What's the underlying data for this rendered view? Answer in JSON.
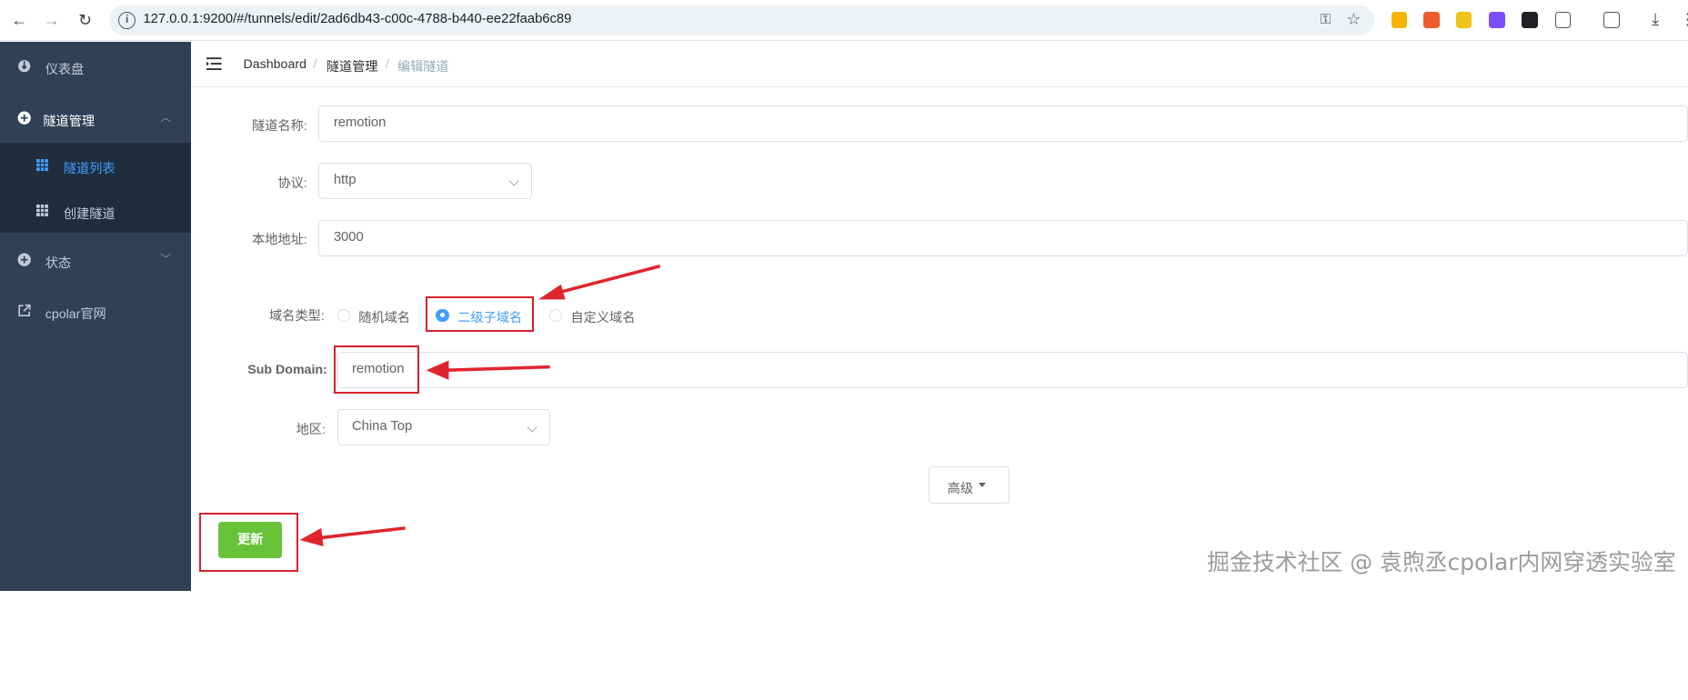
{
  "browser": {
    "url": "127.0.0.1:9200/#/tunnels/edit/2ad6db43-c00c-4788-b440-ee22faab6c89",
    "nav": {
      "back": "←",
      "forward": "→",
      "reload": "↻"
    },
    "key_icon": "⚿",
    "star_icon": "☆",
    "ext_download": "⤓",
    "ext_menu": "⋮"
  },
  "sidebar": {
    "items": [
      {
        "label": "仪表盘"
      },
      {
        "label": "隧道管理",
        "chevron": "︿"
      },
      {
        "label": "状态",
        "chevron": "﹀"
      },
      {
        "label": "cpolar官网"
      }
    ],
    "submenu": [
      {
        "label": "隧道列表",
        "active": true
      },
      {
        "label": "创建隧道"
      }
    ]
  },
  "breadcrumb": {
    "items": [
      "Dashboard",
      "隧道管理",
      "编辑隧道"
    ],
    "separator": "/"
  },
  "form": {
    "tunnel_name": {
      "label": "隧道名称:",
      "value": "remotion"
    },
    "protocol": {
      "label": "协议:",
      "value": "http"
    },
    "local_address": {
      "label": "本地地址:",
      "value": "3000"
    },
    "domain_type": {
      "label": "域名类型:",
      "options": [
        "随机域名",
        "二级子域名",
        "自定义域名"
      ],
      "selected": "二级子域名"
    },
    "sub_domain": {
      "label": "Sub Domain:",
      "value": "remotion"
    },
    "region": {
      "label": "地区:",
      "value": "China Top"
    }
  },
  "buttons": {
    "advanced": "高级",
    "update": "更新"
  },
  "watermark": "掘金技术社区 @ 袁煦丞cpolar内网穿透实验室",
  "colors": {
    "sidebar_bg": "#304156",
    "submenu_bg": "#1f2d3d",
    "accent": "#409eff",
    "update_button": "#67c23a",
    "annotation_red": "#d8202a"
  }
}
